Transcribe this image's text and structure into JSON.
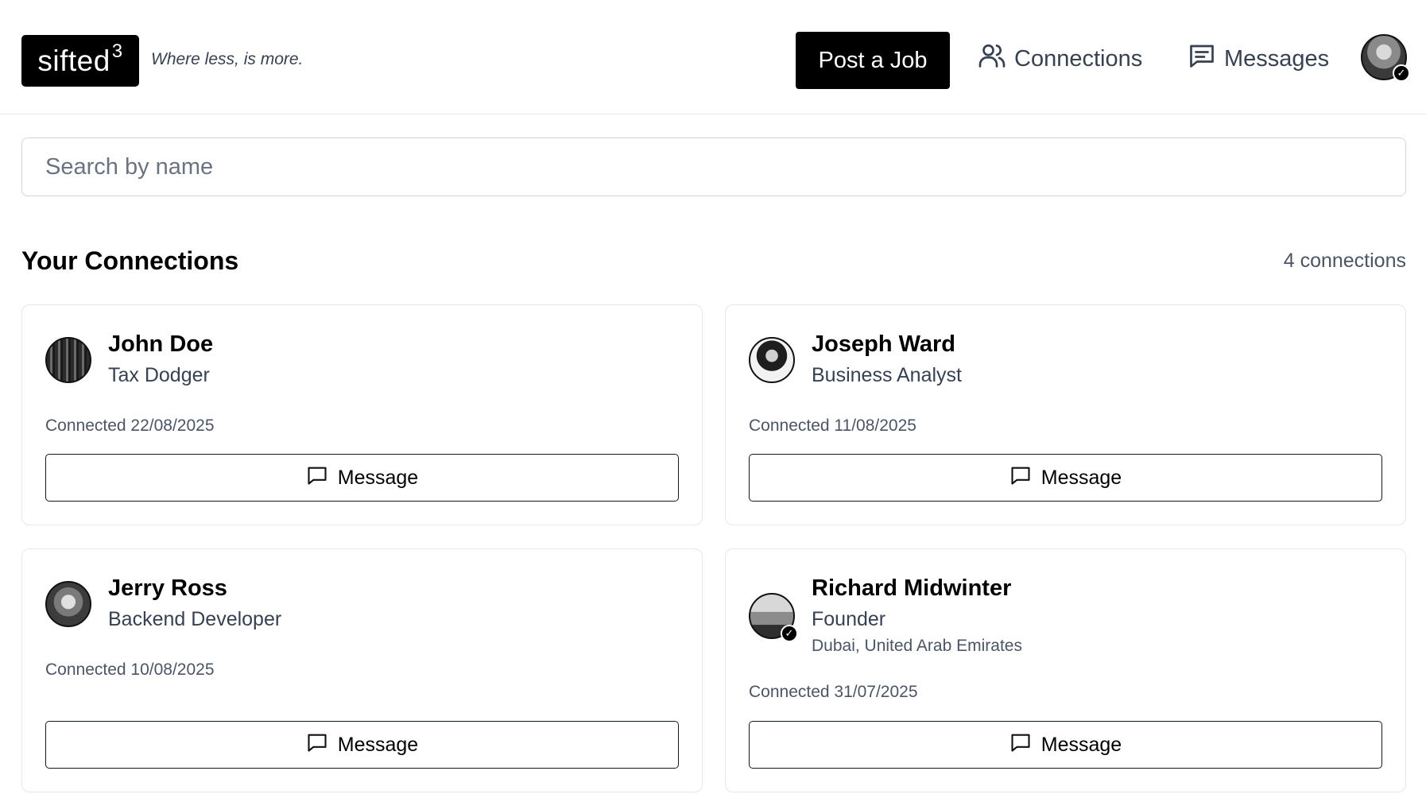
{
  "header": {
    "logo_text": "sifted",
    "logo_sup": "3",
    "tagline": "Where less, is more.",
    "post_job_label": "Post a Job",
    "nav": {
      "connections_label": "Connections",
      "messages_label": "Messages"
    },
    "profile_verified_mark": "✓"
  },
  "search": {
    "placeholder": "Search by name",
    "value": ""
  },
  "section": {
    "title": "Your Connections",
    "count_label": "4 connections"
  },
  "connections": [
    {
      "name": "John Doe",
      "role": "Tax Dodger",
      "location": "",
      "connected": "Connected 22/08/2025",
      "verified": false,
      "button_label": "Message"
    },
    {
      "name": "Joseph Ward",
      "role": "Business Analyst",
      "location": "",
      "connected": "Connected 11/08/2025",
      "verified": false,
      "button_label": "Message"
    },
    {
      "name": "Jerry Ross",
      "role": "Backend Developer",
      "location": "",
      "connected": "Connected 10/08/2025",
      "verified": false,
      "button_label": "Message"
    },
    {
      "name": "Richard Midwinter",
      "role": "Founder",
      "location": "Dubai, United Arab Emirates",
      "connected": "Connected 31/07/2025",
      "verified": true,
      "verified_mark": "✓",
      "button_label": "Message"
    }
  ],
  "colors": {
    "primary": "#000000",
    "border": "#e5e7eb",
    "muted_text": "#4b5563"
  },
  "icons": {
    "connections": "users-icon",
    "messages": "message-square-text-icon",
    "message_button": "message-square-icon"
  }
}
